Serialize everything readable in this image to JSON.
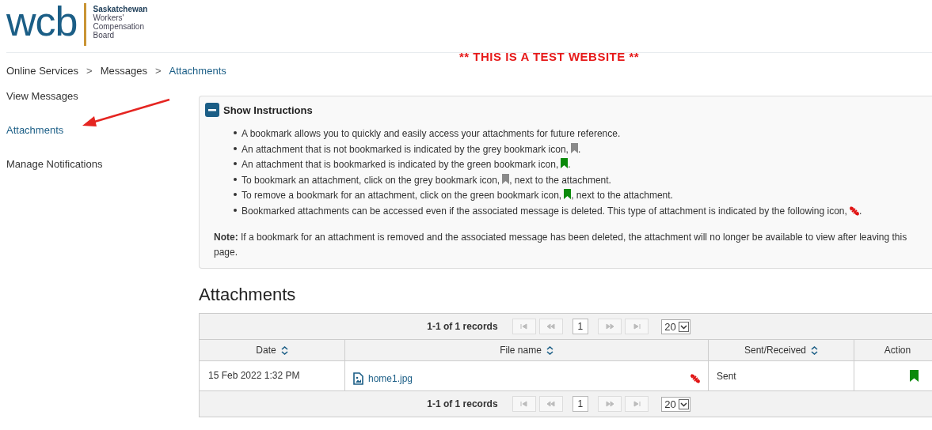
{
  "logo": {
    "mark": "wcb",
    "lines": [
      "Saskatchewan",
      "Workers'",
      "Compensation",
      "Board"
    ]
  },
  "banner": "** THIS IS A TEST WEBSITE **",
  "breadcrumb": [
    {
      "label": "Online Services",
      "current": false
    },
    {
      "label": "Messages",
      "current": false
    },
    {
      "label": "Attachments",
      "current": true
    }
  ],
  "breadcrumb_separator": ">",
  "sidebar": {
    "items": [
      {
        "label": "View Messages",
        "selected": false
      },
      {
        "label": "Attachments",
        "selected": true
      },
      {
        "label": "Manage Notifications",
        "selected": false
      }
    ]
  },
  "instructions": {
    "title": "Show Instructions",
    "expanded": true,
    "items": [
      {
        "kind": "plain",
        "text": "A bookmark allows you to quickly and easily access your attachments for future reference."
      },
      {
        "kind": "bookmark",
        "bookmarked": false,
        "text": "An attachment that is not bookmarked is indicated by the grey bookmark icon,",
        "after": "."
      },
      {
        "kind": "bookmark",
        "bookmarked": true,
        "text": "An attachment that is bookmarked is indicated by the green bookmark icon,",
        "after": "."
      },
      {
        "kind": "bookmark",
        "bookmarked": false,
        "text": "To bookmark an attachment, click on the grey bookmark icon,",
        "after": ", next to the attachment."
      },
      {
        "kind": "bookmark",
        "bookmarked": true,
        "text": "To remove a bookmark for an attachment, click on the green bookmark icon,",
        "after": ", next to the attachment."
      },
      {
        "kind": "deleted",
        "text": "Bookmarked attachments can be accessed even if the associated message is deleted. This type of attachment is indicated by the following icon,",
        "after": "."
      }
    ],
    "note": "**Note:** If a bookmark for an attachment is removed and the associated message has been deleted, the attachment will no longer be available to view after leaving this page."
  },
  "heading": "Attachments",
  "pagers": [
    {
      "summary": "1-1 of 1 records",
      "page": "1",
      "page_size": "20"
    },
    {
      "summary": "1-1 of 1 records",
      "page": "1",
      "page_size": "20"
    }
  ],
  "table": {
    "columns": [
      "Date",
      "File name",
      "Sent/Received",
      "Action"
    ],
    "rows": [
      {
        "date": "15 Feb 2022 1:32 PM",
        "file": "home1.jpg",
        "message_deleted": true,
        "direction": "Sent",
        "bookmarked": true
      }
    ]
  }
}
